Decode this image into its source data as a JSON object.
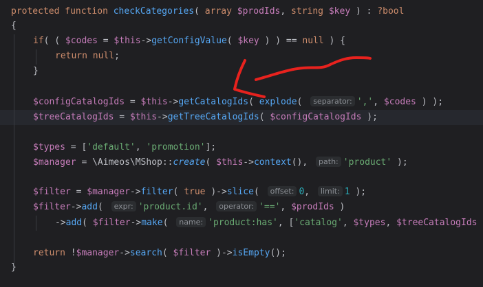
{
  "editor": {
    "lines": [
      {
        "tokens": [
          {
            "c": "t-kw",
            "t": "protected "
          },
          {
            "c": "t-kw",
            "t": "function "
          },
          {
            "c": "t-fn",
            "t": "checkCategories"
          },
          {
            "c": "t-plain",
            "t": "( "
          },
          {
            "c": "t-kw",
            "t": "array "
          },
          {
            "c": "t-var",
            "t": "$prodIds"
          },
          {
            "c": "t-plain",
            "t": ", "
          },
          {
            "c": "t-kw",
            "t": "string "
          },
          {
            "c": "t-var",
            "t": "$key"
          },
          {
            "c": "t-plain",
            "t": " ) : "
          },
          {
            "c": "t-kw",
            "t": "?bool"
          }
        ]
      },
      {
        "tokens": [
          {
            "c": "t-brace",
            "t": "{"
          }
        ]
      },
      {
        "tokens": [
          {
            "c": "t-kw",
            "t": "if"
          },
          {
            "c": "t-plain",
            "t": "( ( "
          },
          {
            "c": "t-var",
            "t": "$codes"
          },
          {
            "c": "t-plain",
            "t": " = "
          },
          {
            "c": "t-var",
            "t": "$this"
          },
          {
            "c": "t-plain",
            "t": "->"
          },
          {
            "c": "t-fn",
            "t": "getConfigValue"
          },
          {
            "c": "t-plain",
            "t": "( "
          },
          {
            "c": "t-var",
            "t": "$key"
          },
          {
            "c": "t-plain",
            "t": " ) ) == "
          },
          {
            "c": "t-kw",
            "t": "null"
          },
          {
            "c": "t-plain",
            "t": " ) {"
          }
        ]
      },
      {
        "tokens": [
          {
            "c": "t-kw",
            "t": "return "
          },
          {
            "c": "t-kw",
            "t": "null"
          },
          {
            "c": "t-plain",
            "t": ";"
          }
        ]
      },
      {
        "tokens": [
          {
            "c": "t-plain",
            "t": "}"
          }
        ]
      },
      {
        "tokens": []
      },
      {
        "tokens": [
          {
            "c": "t-var",
            "t": "$configCatalogIds"
          },
          {
            "c": "t-plain",
            "t": " = "
          },
          {
            "c": "t-var",
            "t": "$this"
          },
          {
            "c": "t-plain",
            "t": "->"
          },
          {
            "c": "t-fn",
            "t": "getCatalogIds"
          },
          {
            "c": "t-plain",
            "t": "( "
          },
          {
            "c": "t-fn",
            "t": "explode"
          },
          {
            "c": "t-plain",
            "t": "( "
          },
          {
            "c": "hint",
            "t": "separator:"
          },
          {
            "c": "t-str",
            "t": "','"
          },
          {
            "c": "t-plain",
            "t": ", "
          },
          {
            "c": "t-var",
            "t": "$codes"
          },
          {
            "c": "t-plain",
            "t": " ) );"
          }
        ]
      },
      {
        "tokens": [
          {
            "c": "t-var",
            "t": "$treeCatalogIds"
          },
          {
            "c": "t-plain",
            "t": " = "
          },
          {
            "c": "t-var",
            "t": "$this"
          },
          {
            "c": "t-plain",
            "t": "->"
          },
          {
            "c": "t-fn",
            "t": "getTreeCatalogIds"
          },
          {
            "c": "t-plain",
            "t": "( "
          },
          {
            "c": "t-var",
            "t": "$configCatalogIds"
          },
          {
            "c": "t-plain",
            "t": " );"
          }
        ]
      },
      {
        "tokens": []
      },
      {
        "tokens": [
          {
            "c": "t-var",
            "t": "$types"
          },
          {
            "c": "t-plain",
            "t": " = ["
          },
          {
            "c": "t-str",
            "t": "'default'"
          },
          {
            "c": "t-plain",
            "t": ", "
          },
          {
            "c": "t-str",
            "t": "'promotion'"
          },
          {
            "c": "t-plain",
            "t": "];"
          }
        ]
      },
      {
        "tokens": [
          {
            "c": "t-var",
            "t": "$manager"
          },
          {
            "c": "t-plain",
            "t": " = \\Aimeos\\MShop::"
          },
          {
            "c": "t-italic",
            "t": "create"
          },
          {
            "c": "t-plain",
            "t": "( "
          },
          {
            "c": "t-var",
            "t": "$this"
          },
          {
            "c": "t-plain",
            "t": "->"
          },
          {
            "c": "t-fn",
            "t": "context"
          },
          {
            "c": "t-plain",
            "t": "(), "
          },
          {
            "c": "hint",
            "t": "path:"
          },
          {
            "c": "t-str",
            "t": "'product'"
          },
          {
            "c": "t-plain",
            "t": " );"
          }
        ]
      },
      {
        "tokens": []
      },
      {
        "tokens": [
          {
            "c": "t-var",
            "t": "$filter"
          },
          {
            "c": "t-plain",
            "t": " = "
          },
          {
            "c": "t-var",
            "t": "$manager"
          },
          {
            "c": "t-plain",
            "t": "->"
          },
          {
            "c": "t-fn",
            "t": "filter"
          },
          {
            "c": "t-plain",
            "t": "( "
          },
          {
            "c": "t-kw",
            "t": "true"
          },
          {
            "c": "t-plain",
            "t": " )->"
          },
          {
            "c": "t-fn",
            "t": "slice"
          },
          {
            "c": "t-plain",
            "t": "( "
          },
          {
            "c": "hint",
            "t": "offset:"
          },
          {
            "c": "t-num",
            "t": "0"
          },
          {
            "c": "t-plain",
            "t": ", "
          },
          {
            "c": "hint",
            "t": "limit:"
          },
          {
            "c": "t-num",
            "t": "1"
          },
          {
            "c": "t-plain",
            "t": " );"
          }
        ]
      },
      {
        "tokens": [
          {
            "c": "t-var",
            "t": "$filter"
          },
          {
            "c": "t-plain",
            "t": "->"
          },
          {
            "c": "t-fn",
            "t": "add"
          },
          {
            "c": "t-plain",
            "t": "( "
          },
          {
            "c": "hint",
            "t": "expr:"
          },
          {
            "c": "t-str",
            "t": "'product.id'"
          },
          {
            "c": "t-plain",
            "t": ", "
          },
          {
            "c": "hint",
            "t": "operator:"
          },
          {
            "c": "t-str",
            "t": "'=='"
          },
          {
            "c": "t-plain",
            "t": ", "
          },
          {
            "c": "t-var",
            "t": "$prodIds"
          },
          {
            "c": "t-plain",
            "t": " )"
          }
        ]
      },
      {
        "tokens": [
          {
            "c": "t-plain",
            "t": "->"
          },
          {
            "c": "t-fn",
            "t": "add"
          },
          {
            "c": "t-plain",
            "t": "( "
          },
          {
            "c": "t-var",
            "t": "$filter"
          },
          {
            "c": "t-plain",
            "t": "->"
          },
          {
            "c": "t-fn",
            "t": "make"
          },
          {
            "c": "t-plain",
            "t": "( "
          },
          {
            "c": "hint",
            "t": "name:"
          },
          {
            "c": "t-str",
            "t": "'product:has'"
          },
          {
            "c": "t-plain",
            "t": ", ["
          },
          {
            "c": "t-str",
            "t": "'catalog'"
          },
          {
            "c": "t-plain",
            "t": ", "
          },
          {
            "c": "t-var",
            "t": "$types"
          },
          {
            "c": "t-plain",
            "t": ", "
          },
          {
            "c": "t-var",
            "t": "$treeCatalogIds"
          }
        ]
      },
      {
        "tokens": []
      },
      {
        "tokens": [
          {
            "c": "t-kw",
            "t": "return "
          },
          {
            "c": "t-plain",
            "t": "!"
          },
          {
            "c": "t-var",
            "t": "$manager"
          },
          {
            "c": "t-plain",
            "t": "->"
          },
          {
            "c": "t-fn",
            "t": "search"
          },
          {
            "c": "t-plain",
            "t": "( "
          },
          {
            "c": "t-var",
            "t": "$filter"
          },
          {
            "c": "t-plain",
            "t": " )->"
          },
          {
            "c": "t-fn",
            "t": "isEmpty"
          },
          {
            "c": "t-plain",
            "t": "();"
          }
        ]
      },
      {
        "tokens": [
          {
            "c": "t-brace",
            "t": "}"
          }
        ]
      }
    ]
  },
  "colors": {
    "background": "#1f1f22",
    "current_line": "#26282e",
    "keyword": "#cf8e6d",
    "function": "#56a8f5",
    "variable": "#c77dbb",
    "string": "#6aab73",
    "number": "#2aacb8",
    "annotation": "#e8221e"
  }
}
